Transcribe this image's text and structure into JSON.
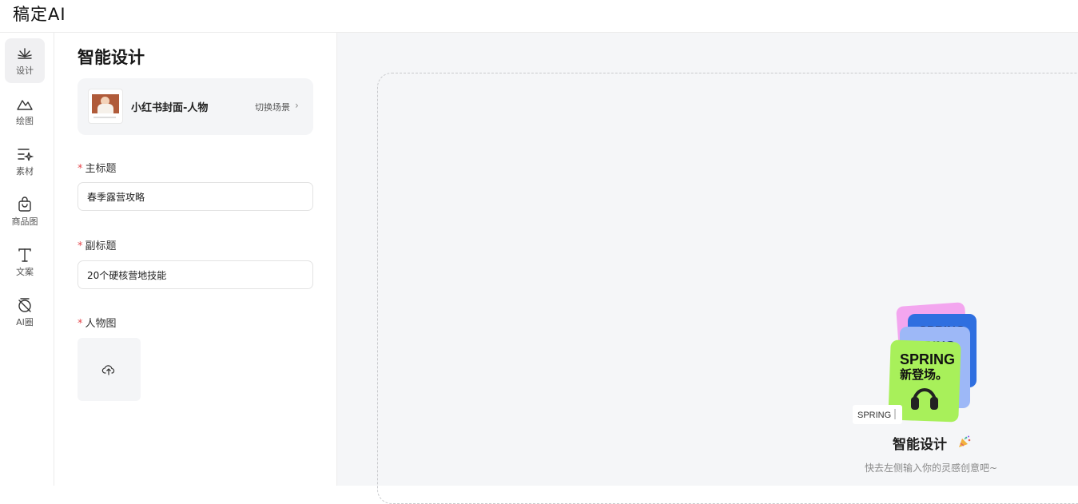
{
  "app": {
    "logo": "稿定AI"
  },
  "sidebar": {
    "items": [
      {
        "label": "设计",
        "icon": "sparkle-icon",
        "active": true
      },
      {
        "label": "绘图",
        "icon": "mountain-icon",
        "active": false
      },
      {
        "label": "素材",
        "icon": "list-star-icon",
        "active": false
      },
      {
        "label": "商品图",
        "icon": "shopping-bag-icon",
        "active": false
      },
      {
        "label": "文案",
        "icon": "text-t-icon",
        "active": false
      },
      {
        "label": "AI圈",
        "icon": "ai-circle-icon",
        "active": false
      }
    ]
  },
  "panel": {
    "title": "智能设计",
    "scene": {
      "name": "小红书封面-人物",
      "switch_label": "切换场景",
      "chevron": "›"
    },
    "fields": {
      "main_title": {
        "label": "主标题",
        "value": "春季露营攻略"
      },
      "subtitle": {
        "label": "副标题",
        "value": "20个硬核营地技能"
      },
      "person_image": {
        "label": "人物图",
        "icon": "cloud-upload-icon"
      }
    },
    "required_mark": "*"
  },
  "canvas": {
    "empty_title": "智能设计",
    "empty_subtitle": "快去左侧输入你的灵感创意吧~",
    "illustration": {
      "tag_text": "SPRING",
      "card_text_1": "SPRING",
      "card_text_2": "新登场。",
      "colors": {
        "pink": "#f3a6ef",
        "blue": "#2f6fe0",
        "lightblue": "#9db8f7",
        "green": "#a8f05a"
      }
    }
  }
}
